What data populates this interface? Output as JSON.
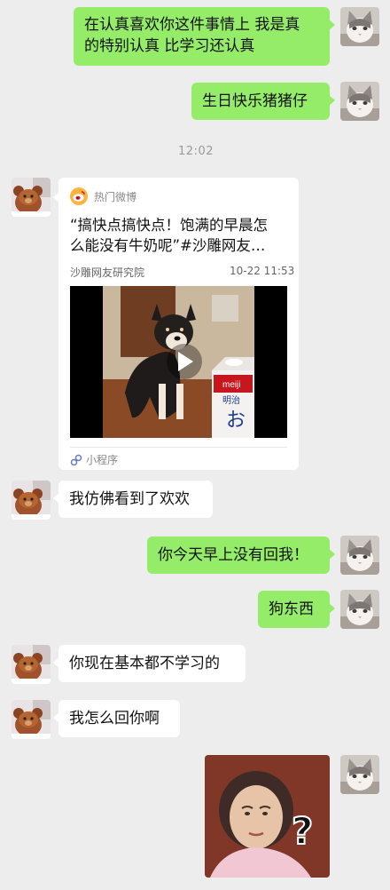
{
  "messages": {
    "m1": {
      "line1": "在认真喜欢你这件事情上 我是真",
      "line2": "的特别认真 比学习还认真"
    },
    "m2": {
      "text": "生日快乐猪猪仔"
    },
    "timestamp": "12:02",
    "card": {
      "source": "热门微博",
      "title_line1": "“搞快点搞快点！饱满的早晨怎",
      "title_line2": "么能没有牛奶呢”#沙雕网友…",
      "author": "沙雕网友研究院",
      "date": "10-22 11:53",
      "footer": "小程序",
      "carton_text_1": "明治",
      "carton_text_2": "お",
      "carton_brand": "meiji"
    },
    "m3": {
      "text": "我仿佛看到了欢欢"
    },
    "m4": {
      "text": "你今天早上没有回我！"
    },
    "m5": {
      "text": "狗东西"
    },
    "m6": {
      "text": "你现在基本都不学习的"
    },
    "m7": {
      "text": "我怎么回你啊"
    },
    "sticker": {
      "symbol": "?"
    }
  },
  "colors": {
    "background": "#ededed",
    "sent_bubble": "#95ec69",
    "received_bubble": "#ffffff"
  }
}
